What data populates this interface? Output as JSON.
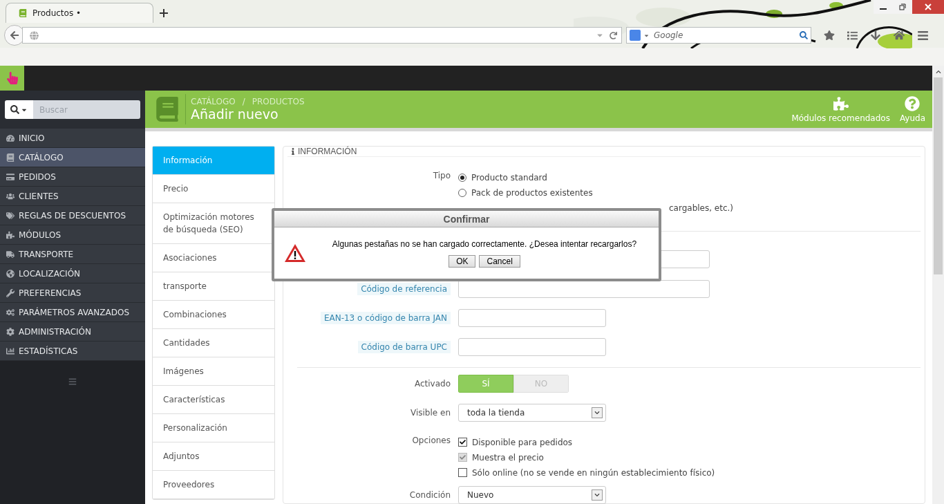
{
  "browser": {
    "tab_title": "Productos •",
    "search_placeholder": "Google"
  },
  "sidebar": {
    "search_placeholder": "Buscar",
    "items": [
      {
        "label": "INICIO",
        "selected": false
      },
      {
        "label": "CATÁLOGO",
        "selected": true
      },
      {
        "label": "PEDIDOS",
        "selected": false
      },
      {
        "label": "CLIENTES",
        "selected": false
      },
      {
        "label": "REGLAS DE DESCUENTOS",
        "selected": false
      },
      {
        "label": "MÓDULOS",
        "selected": false
      },
      {
        "label": "TRANSPORTE",
        "selected": false
      },
      {
        "label": "LOCALIZACIÓN",
        "selected": false
      },
      {
        "label": "PREFERENCIAS",
        "selected": false
      },
      {
        "label": "PARÁMETROS AVANZADOS",
        "selected": false
      },
      {
        "label": "ADMINISTRACIÓN",
        "selected": false
      },
      {
        "label": "ESTADÍSTICAS",
        "selected": false
      }
    ]
  },
  "header": {
    "breadcrumb": [
      "CATÁLOGO",
      "PRODUCTOS"
    ],
    "separator": "/",
    "title": "Añadir nuevo",
    "actions": [
      "Módulos recomendados",
      "Ayuda"
    ]
  },
  "tabs": [
    {
      "label": "Información",
      "selected": true
    },
    {
      "label": "Precio",
      "selected": false
    },
    {
      "label": "Optimización motores de búsqueda (SEO)",
      "selected": false
    },
    {
      "label": "Asociaciones",
      "selected": false
    },
    {
      "label": "transporte",
      "selected": false
    },
    {
      "label": "Combinaciones",
      "selected": false
    },
    {
      "label": "Cantidades",
      "selected": false
    },
    {
      "label": "Imágenes",
      "selected": false
    },
    {
      "label": "Características",
      "selected": false
    },
    {
      "label": "Personalización",
      "selected": false
    },
    {
      "label": "Adjuntos",
      "selected": false
    },
    {
      "label": "Proveedores",
      "selected": false
    }
  ],
  "panel": {
    "title": "INFORMACIÓN",
    "type": {
      "label": "Tipo",
      "options": [
        {
          "label": "Producto standard",
          "selected": true
        },
        {
          "label": "Pack de productos existentes",
          "selected": false
        }
      ],
      "note_fragment": "cargables, etc.)"
    },
    "fields": [
      {
        "label": "Código de referencia",
        "wide": true
      },
      {
        "label": "EAN-13 o código de barra JAN",
        "wide": false
      },
      {
        "label": "Código de barra UPC",
        "wide": false
      }
    ],
    "active": {
      "label": "Activado",
      "on": true,
      "yes": "SÍ",
      "no": "NO"
    },
    "visible_in": {
      "label": "Visible en",
      "value": "toda la tienda"
    },
    "options": {
      "label": "Opciones",
      "items": [
        {
          "label": "Disponible para pedidos",
          "checked": true,
          "disabled": false
        },
        {
          "label": "Muestra el precio",
          "checked": true,
          "disabled": true
        },
        {
          "label": "Sólo online (no se vende en ningún establecimiento físico)",
          "checked": false,
          "disabled": false
        }
      ]
    },
    "condition": {
      "label": "Condición",
      "value": "Nuevo"
    }
  },
  "dialog": {
    "title": "Confirmar",
    "message": "Algunas pestañas no se han cargado correctamente. ¿Desea intentar recargarlos?",
    "buttons": [
      "OK",
      "Cancel"
    ]
  }
}
